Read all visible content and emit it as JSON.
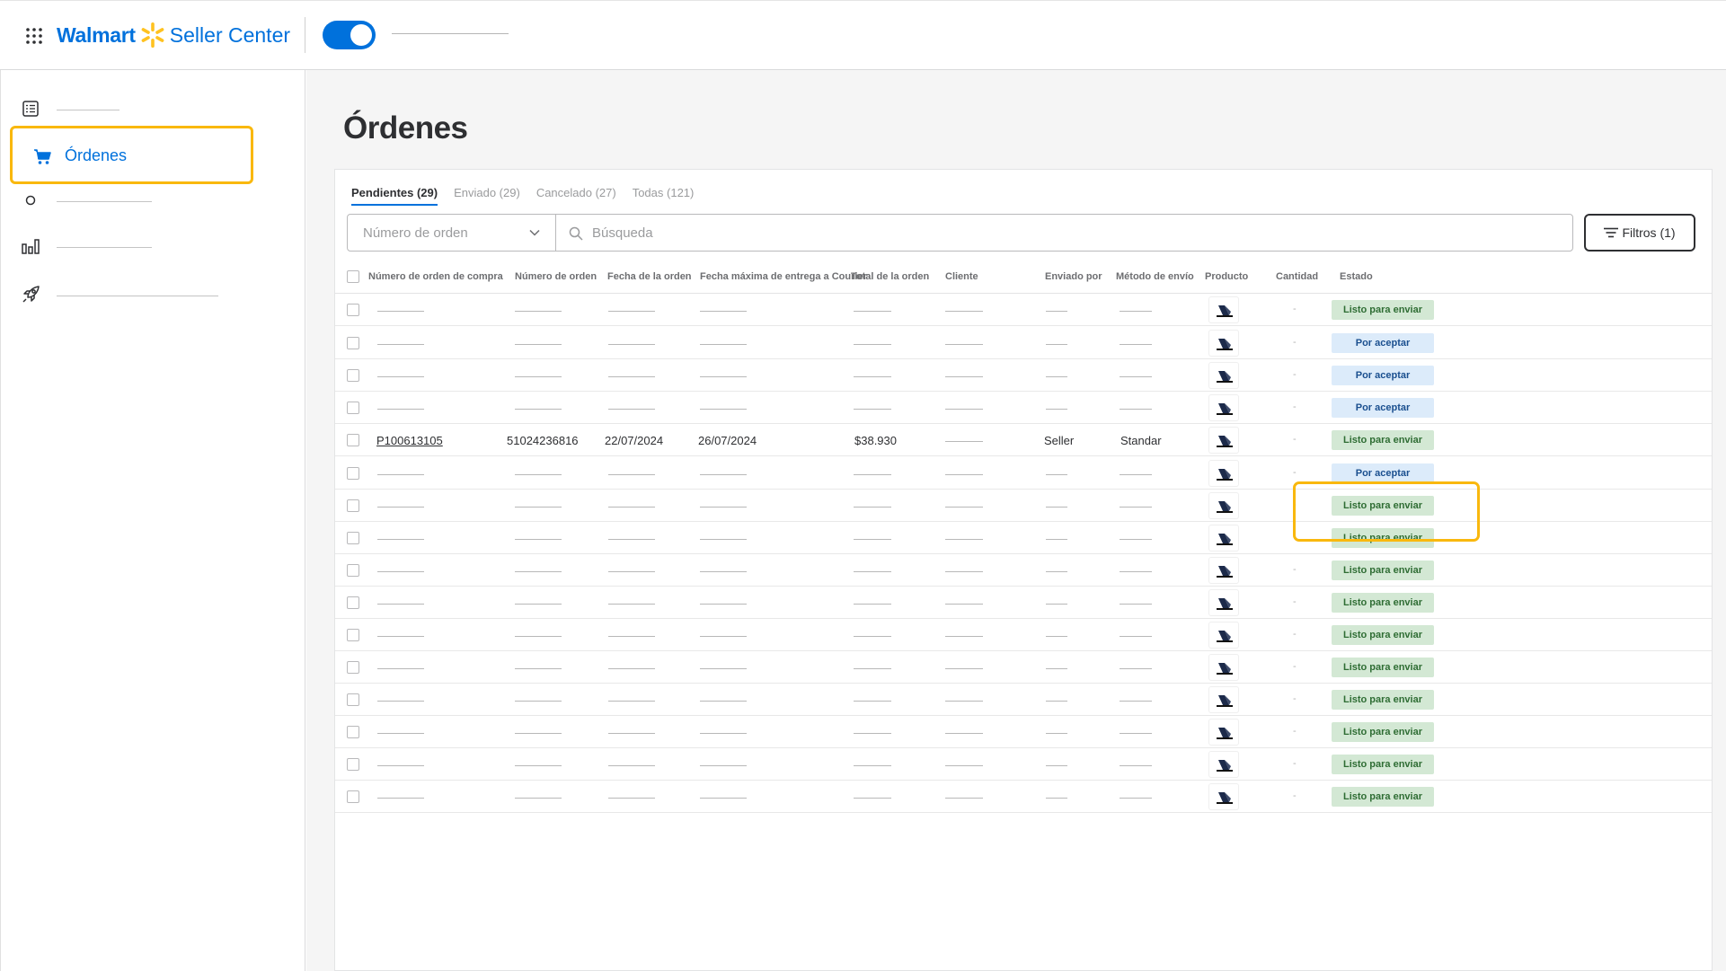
{
  "header": {
    "brand": "Walmart",
    "product": "Seller Center",
    "toggle_on": true
  },
  "sidebar": {
    "items": [
      {
        "icon": "list-icon",
        "label": ""
      },
      {
        "icon": "cart-icon",
        "label": "Órdenes",
        "active": true
      },
      {
        "icon": "circle-icon",
        "label": ""
      },
      {
        "icon": "bar-chart-icon",
        "label": ""
      },
      {
        "icon": "rocket-icon",
        "label": ""
      }
    ]
  },
  "main": {
    "title": "Órdenes",
    "tabs": [
      {
        "label": "Pendientes (29)",
        "active": true
      },
      {
        "label": "Enviado (29)"
      },
      {
        "label": "Cancelado (27)"
      },
      {
        "label": "Todas (121)"
      }
    ],
    "order_select": {
      "placeholder": "Número de orden"
    },
    "search": {
      "placeholder": "Búsqueda"
    },
    "filters_label": "Filtros (1)",
    "columns": [
      "Número de orden de compra",
      "Número de orden",
      "Fecha de la orden",
      "Fecha máxima de entrega a Courier",
      "Total de la orden",
      "Cliente",
      "Enviado por",
      "Método de envío",
      "Producto",
      "Cantidad",
      "Estado"
    ],
    "status_labels": {
      "ready": "Listo para enviar",
      "pending": "Por aceptar"
    },
    "qty_placeholder": "-",
    "rows": [
      {
        "status": "ready"
      },
      {
        "status": "pending"
      },
      {
        "status": "pending"
      },
      {
        "status": "pending"
      },
      {
        "status": "ready",
        "purchase_order": "P100613105",
        "order_number": "51024236816",
        "order_date": "22/07/2024",
        "max_delivery": "26/07/2024",
        "total": "$38.930",
        "shipped_by": "Seller",
        "method": "Standar"
      },
      {
        "status": "pending"
      },
      {
        "status": "ready"
      },
      {
        "status": "ready"
      },
      {
        "status": "ready"
      },
      {
        "status": "ready"
      },
      {
        "status": "ready"
      },
      {
        "status": "ready"
      },
      {
        "status": "ready"
      },
      {
        "status": "ready"
      },
      {
        "status": "ready"
      },
      {
        "status": "ready"
      }
    ]
  },
  "colors": {
    "brand_blue": "#0071dc",
    "spark_yellow": "#ffc220",
    "highlight": "#f9b80e",
    "ready_bg": "#d3e8d4",
    "pending_bg": "#dcebfa"
  }
}
